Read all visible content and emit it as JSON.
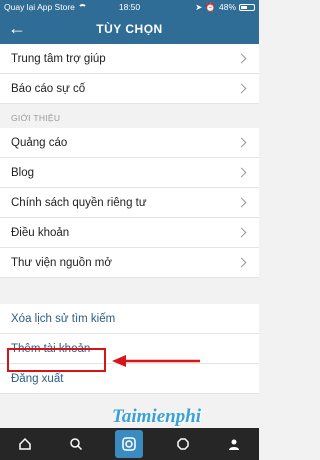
{
  "status_bar": {
    "carrier": "Quay lại App Store",
    "time": "18:50",
    "battery": "48%"
  },
  "header": {
    "back_label": "←",
    "title": "TÙY CHỌN"
  },
  "support_items": [
    {
      "label": "Trung tâm trợ giúp"
    },
    {
      "label": "Báo cáo sự cố"
    }
  ],
  "about_section": {
    "header": "GIỚI THIỆU",
    "items": [
      {
        "label": "Quảng cáo"
      },
      {
        "label": "Blog"
      },
      {
        "label": "Chính sách quyền riêng tư"
      },
      {
        "label": "Điều khoản"
      },
      {
        "label": "Thư viện nguồn mở"
      }
    ]
  },
  "account_items": [
    {
      "label": "Xóa lịch sử tìm kiếm"
    },
    {
      "label": "Thêm tài khoản"
    },
    {
      "label": "Đăng xuất"
    }
  ],
  "watermark": "Taimienphi",
  "colors": {
    "header_bg": "#2f6c96",
    "highlight": "#d8141b",
    "tabbar_bg": "#262626",
    "tab_active": "#3a8bbf"
  },
  "tabs": [
    {
      "icon": "home-icon"
    },
    {
      "icon": "search-icon"
    },
    {
      "icon": "camera-icon"
    },
    {
      "icon": "activity-icon"
    },
    {
      "icon": "profile-icon"
    }
  ]
}
